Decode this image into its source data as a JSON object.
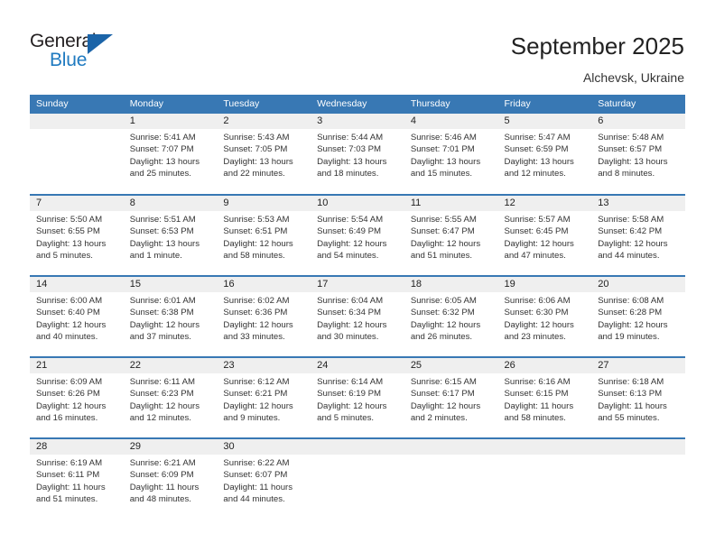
{
  "brand": {
    "name_dark": "General",
    "name_blue": "Blue",
    "triangle_color": "#1b64a8",
    "blue_color": "#1f7ac0"
  },
  "header": {
    "title": "September 2025",
    "location": "Alchevsk, Ukraine"
  },
  "theme": {
    "header_row_color": "#3878b4",
    "daynum_strip_color": "#efefef",
    "separator_color": "#3878b4",
    "text_color": "#333333"
  },
  "weekdays": [
    "Sunday",
    "Monday",
    "Tuesday",
    "Wednesday",
    "Thursday",
    "Friday",
    "Saturday"
  ],
  "weeks": [
    [
      {
        "day": "",
        "empty": true,
        "lines": []
      },
      {
        "day": "1",
        "lines": [
          "Sunrise: 5:41 AM",
          "Sunset: 7:07 PM",
          "Daylight: 13 hours",
          "and 25 minutes."
        ]
      },
      {
        "day": "2",
        "lines": [
          "Sunrise: 5:43 AM",
          "Sunset: 7:05 PM",
          "Daylight: 13 hours",
          "and 22 minutes."
        ]
      },
      {
        "day": "3",
        "lines": [
          "Sunrise: 5:44 AM",
          "Sunset: 7:03 PM",
          "Daylight: 13 hours",
          "and 18 minutes."
        ]
      },
      {
        "day": "4",
        "lines": [
          "Sunrise: 5:46 AM",
          "Sunset: 7:01 PM",
          "Daylight: 13 hours",
          "and 15 minutes."
        ]
      },
      {
        "day": "5",
        "lines": [
          "Sunrise: 5:47 AM",
          "Sunset: 6:59 PM",
          "Daylight: 13 hours",
          "and 12 minutes."
        ]
      },
      {
        "day": "6",
        "lines": [
          "Sunrise: 5:48 AM",
          "Sunset: 6:57 PM",
          "Daylight: 13 hours",
          "and 8 minutes."
        ]
      }
    ],
    [
      {
        "day": "7",
        "lines": [
          "Sunrise: 5:50 AM",
          "Sunset: 6:55 PM",
          "Daylight: 13 hours",
          "and 5 minutes."
        ]
      },
      {
        "day": "8",
        "lines": [
          "Sunrise: 5:51 AM",
          "Sunset: 6:53 PM",
          "Daylight: 13 hours",
          "and 1 minute."
        ]
      },
      {
        "day": "9",
        "lines": [
          "Sunrise: 5:53 AM",
          "Sunset: 6:51 PM",
          "Daylight: 12 hours",
          "and 58 minutes."
        ]
      },
      {
        "day": "10",
        "lines": [
          "Sunrise: 5:54 AM",
          "Sunset: 6:49 PM",
          "Daylight: 12 hours",
          "and 54 minutes."
        ]
      },
      {
        "day": "11",
        "lines": [
          "Sunrise: 5:55 AM",
          "Sunset: 6:47 PM",
          "Daylight: 12 hours",
          "and 51 minutes."
        ]
      },
      {
        "day": "12",
        "lines": [
          "Sunrise: 5:57 AM",
          "Sunset: 6:45 PM",
          "Daylight: 12 hours",
          "and 47 minutes."
        ]
      },
      {
        "day": "13",
        "lines": [
          "Sunrise: 5:58 AM",
          "Sunset: 6:42 PM",
          "Daylight: 12 hours",
          "and 44 minutes."
        ]
      }
    ],
    [
      {
        "day": "14",
        "lines": [
          "Sunrise: 6:00 AM",
          "Sunset: 6:40 PM",
          "Daylight: 12 hours",
          "and 40 minutes."
        ]
      },
      {
        "day": "15",
        "lines": [
          "Sunrise: 6:01 AM",
          "Sunset: 6:38 PM",
          "Daylight: 12 hours",
          "and 37 minutes."
        ]
      },
      {
        "day": "16",
        "lines": [
          "Sunrise: 6:02 AM",
          "Sunset: 6:36 PM",
          "Daylight: 12 hours",
          "and 33 minutes."
        ]
      },
      {
        "day": "17",
        "lines": [
          "Sunrise: 6:04 AM",
          "Sunset: 6:34 PM",
          "Daylight: 12 hours",
          "and 30 minutes."
        ]
      },
      {
        "day": "18",
        "lines": [
          "Sunrise: 6:05 AM",
          "Sunset: 6:32 PM",
          "Daylight: 12 hours",
          "and 26 minutes."
        ]
      },
      {
        "day": "19",
        "lines": [
          "Sunrise: 6:06 AM",
          "Sunset: 6:30 PM",
          "Daylight: 12 hours",
          "and 23 minutes."
        ]
      },
      {
        "day": "20",
        "lines": [
          "Sunrise: 6:08 AM",
          "Sunset: 6:28 PM",
          "Daylight: 12 hours",
          "and 19 minutes."
        ]
      }
    ],
    [
      {
        "day": "21",
        "lines": [
          "Sunrise: 6:09 AM",
          "Sunset: 6:26 PM",
          "Daylight: 12 hours",
          "and 16 minutes."
        ]
      },
      {
        "day": "22",
        "lines": [
          "Sunrise: 6:11 AM",
          "Sunset: 6:23 PM",
          "Daylight: 12 hours",
          "and 12 minutes."
        ]
      },
      {
        "day": "23",
        "lines": [
          "Sunrise: 6:12 AM",
          "Sunset: 6:21 PM",
          "Daylight: 12 hours",
          "and 9 minutes."
        ]
      },
      {
        "day": "24",
        "lines": [
          "Sunrise: 6:14 AM",
          "Sunset: 6:19 PM",
          "Daylight: 12 hours",
          "and 5 minutes."
        ]
      },
      {
        "day": "25",
        "lines": [
          "Sunrise: 6:15 AM",
          "Sunset: 6:17 PM",
          "Daylight: 12 hours",
          "and 2 minutes."
        ]
      },
      {
        "day": "26",
        "lines": [
          "Sunrise: 6:16 AM",
          "Sunset: 6:15 PM",
          "Daylight: 11 hours",
          "and 58 minutes."
        ]
      },
      {
        "day": "27",
        "lines": [
          "Sunrise: 6:18 AM",
          "Sunset: 6:13 PM",
          "Daylight: 11 hours",
          "and 55 minutes."
        ]
      }
    ],
    [
      {
        "day": "28",
        "lines": [
          "Sunrise: 6:19 AM",
          "Sunset: 6:11 PM",
          "Daylight: 11 hours",
          "and 51 minutes."
        ]
      },
      {
        "day": "29",
        "lines": [
          "Sunrise: 6:21 AM",
          "Sunset: 6:09 PM",
          "Daylight: 11 hours",
          "and 48 minutes."
        ]
      },
      {
        "day": "30",
        "lines": [
          "Sunrise: 6:22 AM",
          "Sunset: 6:07 PM",
          "Daylight: 11 hours",
          "and 44 minutes."
        ]
      },
      {
        "day": "",
        "empty": true,
        "lines": []
      },
      {
        "day": "",
        "empty": true,
        "lines": []
      },
      {
        "day": "",
        "empty": true,
        "lines": []
      },
      {
        "day": "",
        "empty": true,
        "lines": []
      }
    ]
  ]
}
